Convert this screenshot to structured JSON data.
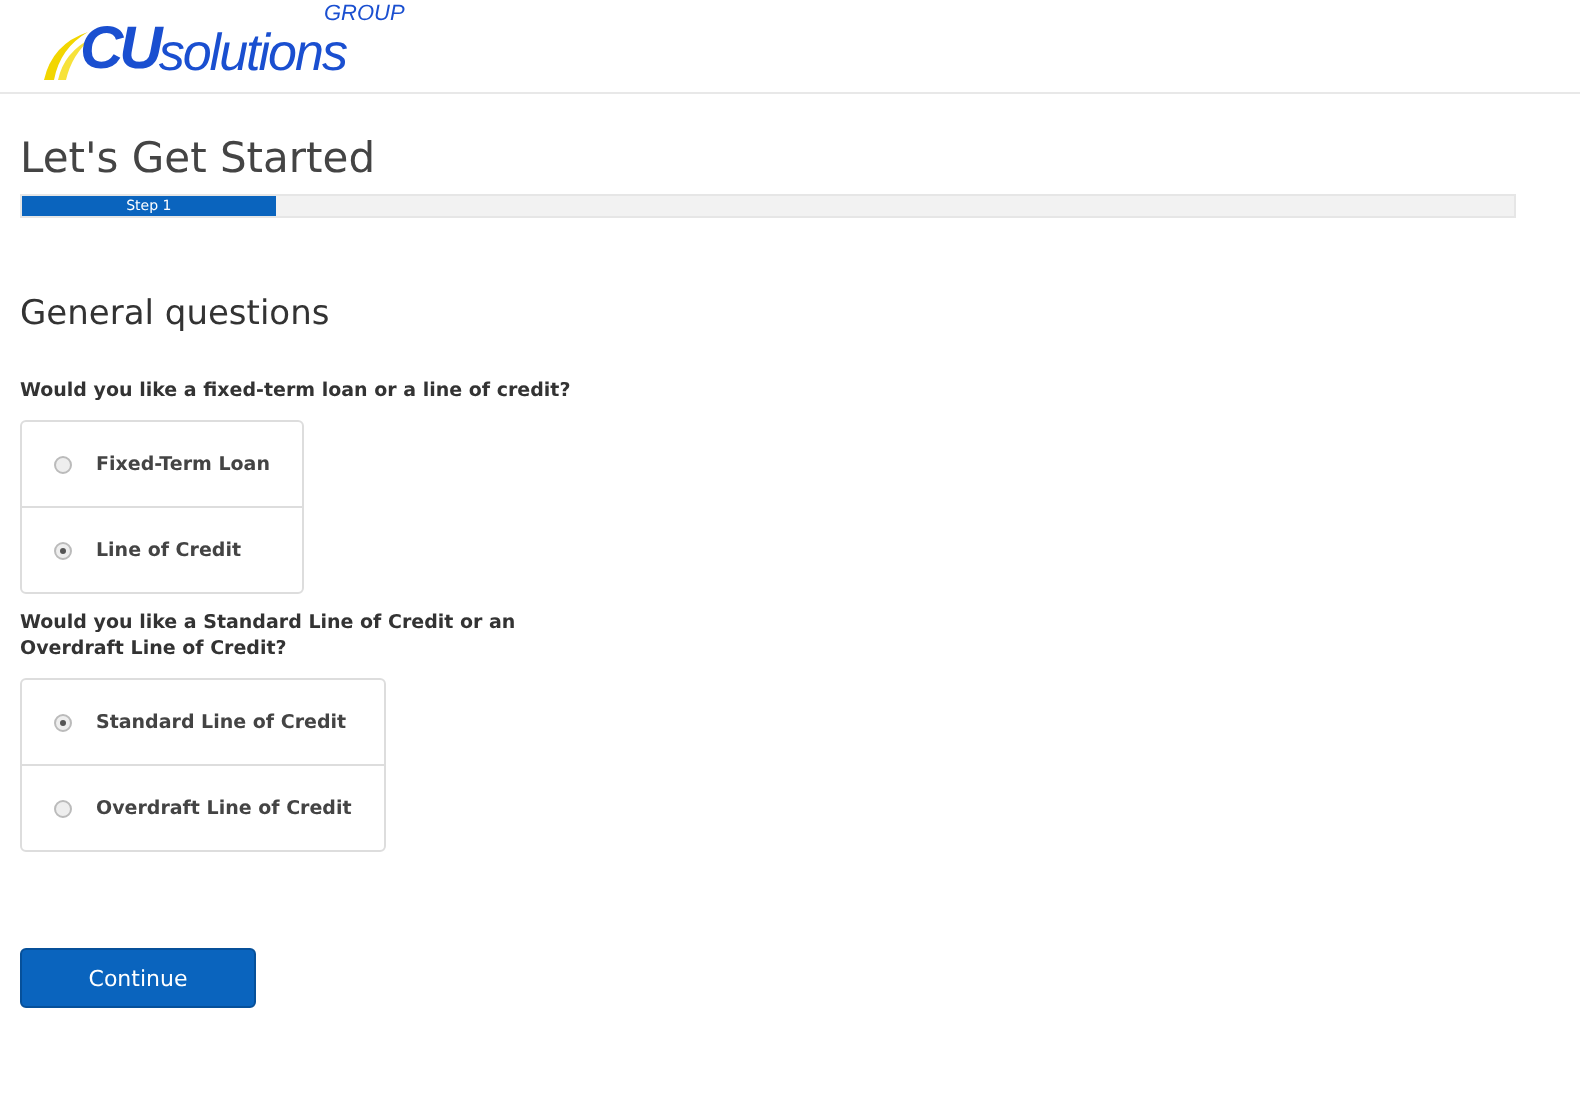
{
  "logo": {
    "mark": "CU",
    "word": "solutions",
    "group": "GROUP"
  },
  "title": "Let's Get Started",
  "progress": {
    "label": "Step 1",
    "level": 0.17
  },
  "section_title": "General questions",
  "questions": [
    {
      "text": "Would you like a fixed-term loan or a line of credit?",
      "options": [
        {
          "label": "Fixed-Term Loan",
          "selected": false
        },
        {
          "label": "Line of Credit",
          "selected": true
        }
      ]
    },
    {
      "text": "Would you like a Standard Line of Credit or an Overdraft Line of Credit?",
      "options": [
        {
          "label": "Standard Line of Credit",
          "selected": true
        },
        {
          "label": "Overdraft Line of Credit",
          "selected": false
        }
      ]
    }
  ],
  "continue_button": "Continue"
}
